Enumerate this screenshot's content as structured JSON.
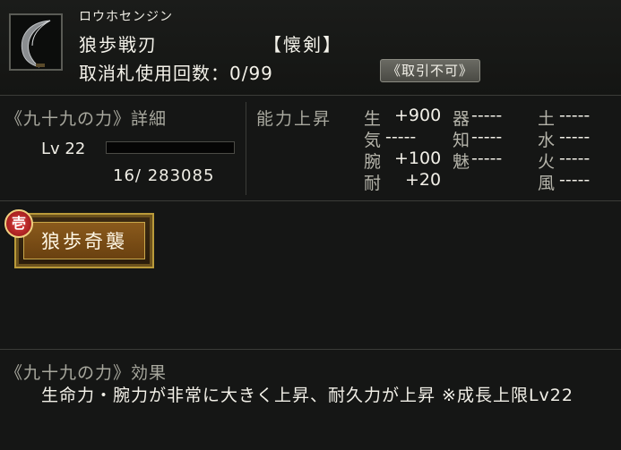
{
  "item": {
    "furigana": "ロウホセンジン",
    "name": "狼歩戦刃",
    "type": "【懐剣】",
    "usage_label": "取消札使用回数：0/99",
    "trade_badge": "《取引不可》",
    "icon": "curved-blade-icon"
  },
  "detail": {
    "title": "《九十九の力》詳細",
    "level": "Lv 22",
    "progress": 0.0,
    "exp": "16/  283085"
  },
  "ability": {
    "title": "能力上昇",
    "stats": [
      {
        "label": "生",
        "value": "+900"
      },
      {
        "label": "器",
        "value": "-----"
      },
      {
        "label": "土",
        "value": "-----"
      },
      {
        "label": "気",
        "value": "-----"
      },
      {
        "label": "知",
        "value": "-----"
      },
      {
        "label": "水",
        "value": "-----"
      },
      {
        "label": "腕",
        "value": "+100"
      },
      {
        "label": "魅",
        "value": "-----"
      },
      {
        "label": "火",
        "value": "-----"
      },
      {
        "label": "耐",
        "value": "+20"
      },
      {
        "label": "風",
        "value": "-----"
      }
    ]
  },
  "skill": {
    "rank": "壱",
    "name": "狼歩奇襲"
  },
  "effect": {
    "title": "《九十九の力》効果",
    "text": "生命力・腕力が非常に大きく上昇、耐久力が上昇 ※成長上限Lv22"
  }
}
